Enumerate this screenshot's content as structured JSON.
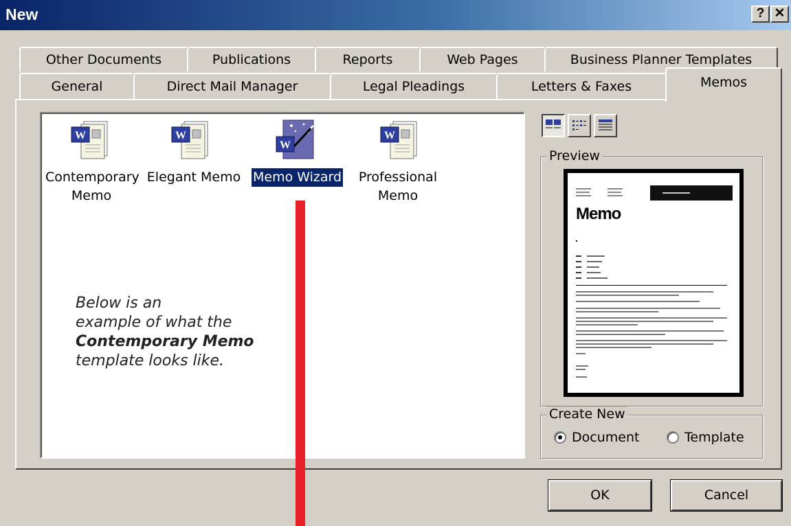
{
  "window": {
    "title": "New",
    "help_label": "?",
    "close_label": "✕"
  },
  "tabs": {
    "row1": [
      "Other Documents",
      "Publications",
      "Reports",
      "Web Pages",
      "Business Planner Templates"
    ],
    "row2": [
      "General",
      "Direct Mail Manager",
      "Legal Pleadings",
      "Letters & Faxes",
      "Memos"
    ],
    "active": "Memos"
  },
  "files": [
    {
      "line1": "Contemporary",
      "line2": "Memo",
      "icon": "word-document-icon",
      "selected": false
    },
    {
      "line1": "Elegant Memo",
      "line2": "",
      "icon": "word-document-icon",
      "selected": false
    },
    {
      "line1": "Memo Wizard",
      "line2": "",
      "icon": "word-wizard-icon",
      "selected": true
    },
    {
      "line1": "Professional",
      "line2": "Memo",
      "icon": "word-document-icon",
      "selected": false
    }
  ],
  "note": {
    "line1": "Below is an",
    "line2": "example of what the",
    "line3": "Contemporary Memo",
    "line4": "template looks like."
  },
  "view_buttons": [
    {
      "icon": "large-icons-view-icon",
      "pressed": true
    },
    {
      "icon": "list-view-icon",
      "pressed": false
    },
    {
      "icon": "details-view-icon",
      "pressed": false
    }
  ],
  "preview": {
    "label": "Preview",
    "page_heading": "Memo"
  },
  "create_new": {
    "label": "Create New",
    "document_label": "Document",
    "template_label": "Template",
    "selected": "Document"
  },
  "buttons": {
    "ok": "OK",
    "cancel": "Cancel"
  },
  "colors": {
    "title_start": "#0a246a",
    "title_end": "#a6caf0",
    "selection": "#0a246a",
    "annotation_bar": "#e8202a"
  }
}
